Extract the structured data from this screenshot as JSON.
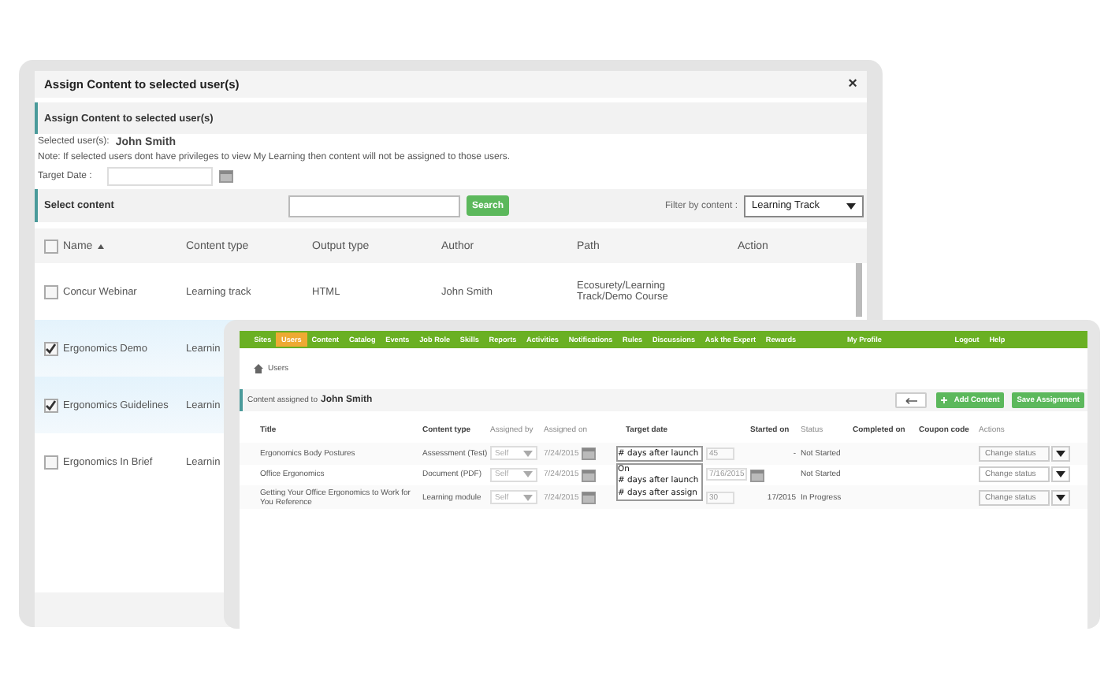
{
  "assign_dialog": {
    "title": "Assign Content to selected user(s)",
    "close": "×",
    "section_title": "Assign Content to selected user(s)",
    "selected_users_label": "Selected user(s):",
    "selected_users": "John Smith",
    "note": "Note: If selected users dont have privileges to view My Learning then content will not be assigned to those users.",
    "target_date_label": "Target Date :",
    "select_content_title": "Select content",
    "search_button": "Search",
    "filter_label": "Filter by content :",
    "filter_value": "Learning Track",
    "select_all_checked": false,
    "columns": [
      "Name",
      "Content type",
      "Output type",
      "Author",
      "Path",
      "Action"
    ],
    "rows": [
      {
        "name": "Concur Webinar",
        "content_type": "Learning track",
        "output_type": "HTML",
        "author": "John Smith",
        "path": "Ecosurety/Learning Track/Demo Course",
        "checked": false
      },
      {
        "name": "Ergonomics Demo",
        "content_type": "Learnin",
        "checked": true
      },
      {
        "name": "Ergonomics Guidelines",
        "content_type": "Learnin",
        "checked": true
      },
      {
        "name": "Ergonomics In Brief",
        "content_type": "Learnin",
        "checked": false
      }
    ]
  },
  "assignments_window": {
    "nav": [
      {
        "label": "Sites",
        "selected": false
      },
      {
        "label": "Users",
        "selected": true
      },
      {
        "label": "Content",
        "selected": false
      },
      {
        "label": "Catalog",
        "selected": false
      },
      {
        "label": "Events",
        "selected": false
      },
      {
        "label": "Job Role",
        "selected": false
      },
      {
        "label": "Skills",
        "selected": false
      },
      {
        "label": "Reports",
        "selected": false
      },
      {
        "label": "Activities",
        "selected": false
      },
      {
        "label": "Notifications",
        "selected": false
      },
      {
        "label": "Rules",
        "selected": false
      },
      {
        "label": "Discussions",
        "selected": false
      },
      {
        "label": "Ask the Expert",
        "selected": false
      },
      {
        "label": "Rewards",
        "selected": false
      },
      {
        "label": "My Profile",
        "selected": false
      },
      {
        "label": "Logout",
        "selected": false
      },
      {
        "label": "Help",
        "selected": false
      }
    ],
    "breadcrumb": "Users",
    "header_label": "Content assigned to",
    "header_user": "John Smith",
    "add_button": "Add Content",
    "save_button": "Save Assignment",
    "columns": [
      "Title",
      "Content type",
      "Assigned by",
      "Assigned on",
      "Target date",
      "Started on",
      "Status",
      "Completed on",
      "Coupon code",
      "Actions"
    ],
    "rows": [
      {
        "title": "Ergonomics Body Postures",
        "content_type": "Assessment (Test)",
        "assigned_by": "Self",
        "assigned_on": "7/24/2015",
        "target_date": "# days after launch",
        "kind": "days",
        "target_value": "45",
        "started_on": "-",
        "status": "Not Started",
        "action": "Change status"
      },
      {
        "title": "Office Ergonomics",
        "content_type": "Document (PDF)",
        "assigned_by": "Self",
        "assigned_on": "7/24/2015",
        "target_options": [
          "On",
          "# days after launch",
          "# days after assign"
        ],
        "kind": "date",
        "target_value": "7/16/2015",
        "status": "Not Started",
        "action": "Change status"
      },
      {
        "title": "Getting Your Office Ergonomics to Work for You Reference",
        "content_type": "Learning module",
        "assigned_by": "Self",
        "assigned_on": "7/24/2015",
        "kind": "days",
        "target_value": "30",
        "started_on": "17/2015",
        "status": "In Progress",
        "action": "Change status"
      }
    ]
  }
}
